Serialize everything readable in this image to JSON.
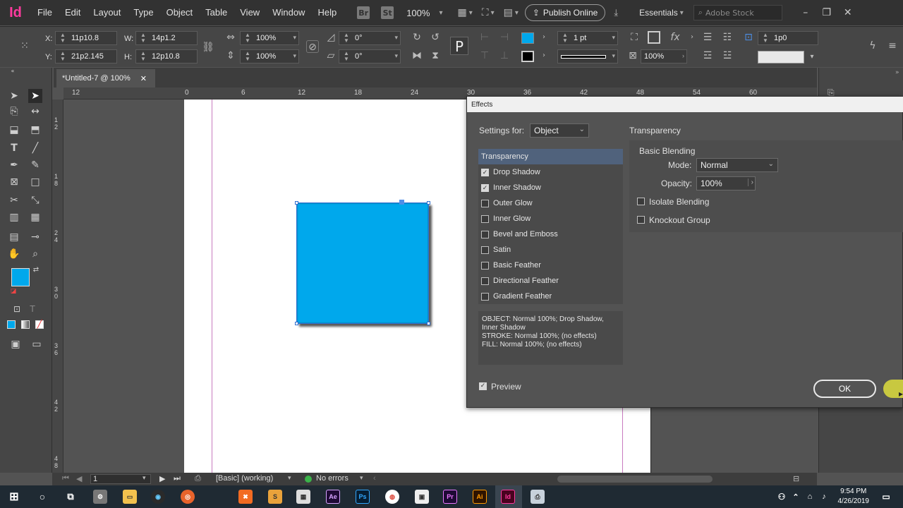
{
  "app": {
    "logo": "Id",
    "menu": [
      "File",
      "Edit",
      "Layout",
      "Type",
      "Object",
      "Table",
      "View",
      "Window",
      "Help"
    ],
    "bridge_icon": "Br",
    "stock_icon": "St",
    "zoom": "100%",
    "publish_label": "Publish Online",
    "workspace": "Essentials",
    "stock_search_placeholder": "Adobe Stock"
  },
  "control_panel": {
    "x_label": "X:",
    "x_value": "11p10.8",
    "y_label": "Y:",
    "y_value": "21p2.145",
    "w_label": "W:",
    "w_value": "14p1.2",
    "h_label": "H:",
    "h_value": "12p10.8",
    "scale_x": "100%",
    "scale_y": "100%",
    "rotate": "0°",
    "shear": "0°",
    "stroke_weight": "1 pt",
    "opacity": "100%",
    "offset": "1p0"
  },
  "document_tab": {
    "title": "*Untitled-7 @ 100%"
  },
  "rulers": {
    "horizontal": [
      "12",
      "0",
      "6",
      "12",
      "18",
      "24",
      "30",
      "36",
      "42",
      "48",
      "54",
      "60"
    ],
    "vertical": [
      "1\n2",
      "1\n8",
      "2\n4",
      "3\n0",
      "3\n6",
      "4\n2",
      "4\n8"
    ]
  },
  "status_bar": {
    "page": "1",
    "style": "[Basic] (working)",
    "preflight": "No errors"
  },
  "effects_dialog": {
    "title": "Effects",
    "settings_for_label": "Settings for:",
    "settings_for_value": "Object",
    "section_title": "Transparency",
    "effects": [
      {
        "label": "Transparency",
        "checked": null,
        "selected": true
      },
      {
        "label": "Drop Shadow",
        "checked": true
      },
      {
        "label": "Inner Shadow",
        "checked": true
      },
      {
        "label": "Outer Glow",
        "checked": false
      },
      {
        "label": "Inner Glow",
        "checked": false
      },
      {
        "label": "Bevel and Emboss",
        "checked": false
      },
      {
        "label": "Satin",
        "checked": false
      },
      {
        "label": "Basic Feather",
        "checked": false
      },
      {
        "label": "Directional Feather",
        "checked": false
      },
      {
        "label": "Gradient Feather",
        "checked": false
      }
    ],
    "summary": "OBJECT: Normal 100%; Drop Shadow, Inner Shadow\nSTROKE: Normal 100%; (no effects)\nFILL: Normal 100%; (no effects)",
    "basic_blending_label": "Basic Blending",
    "mode_label": "Mode:",
    "mode_value": "Normal",
    "opacity_label": "Opacity:",
    "opacity_value": "100%",
    "isolate_blending_label": "Isolate Blending",
    "knockout_group_label": "Knockout Group",
    "preview_label": "Preview",
    "ok_label": "OK"
  },
  "taskbar": {
    "time": "9:54 PM",
    "date": "4/26/2019"
  },
  "colors": {
    "object_fill": "#00a8ec",
    "indesign_brand": "#ff3a9e",
    "selection": "#2f6fd0"
  }
}
